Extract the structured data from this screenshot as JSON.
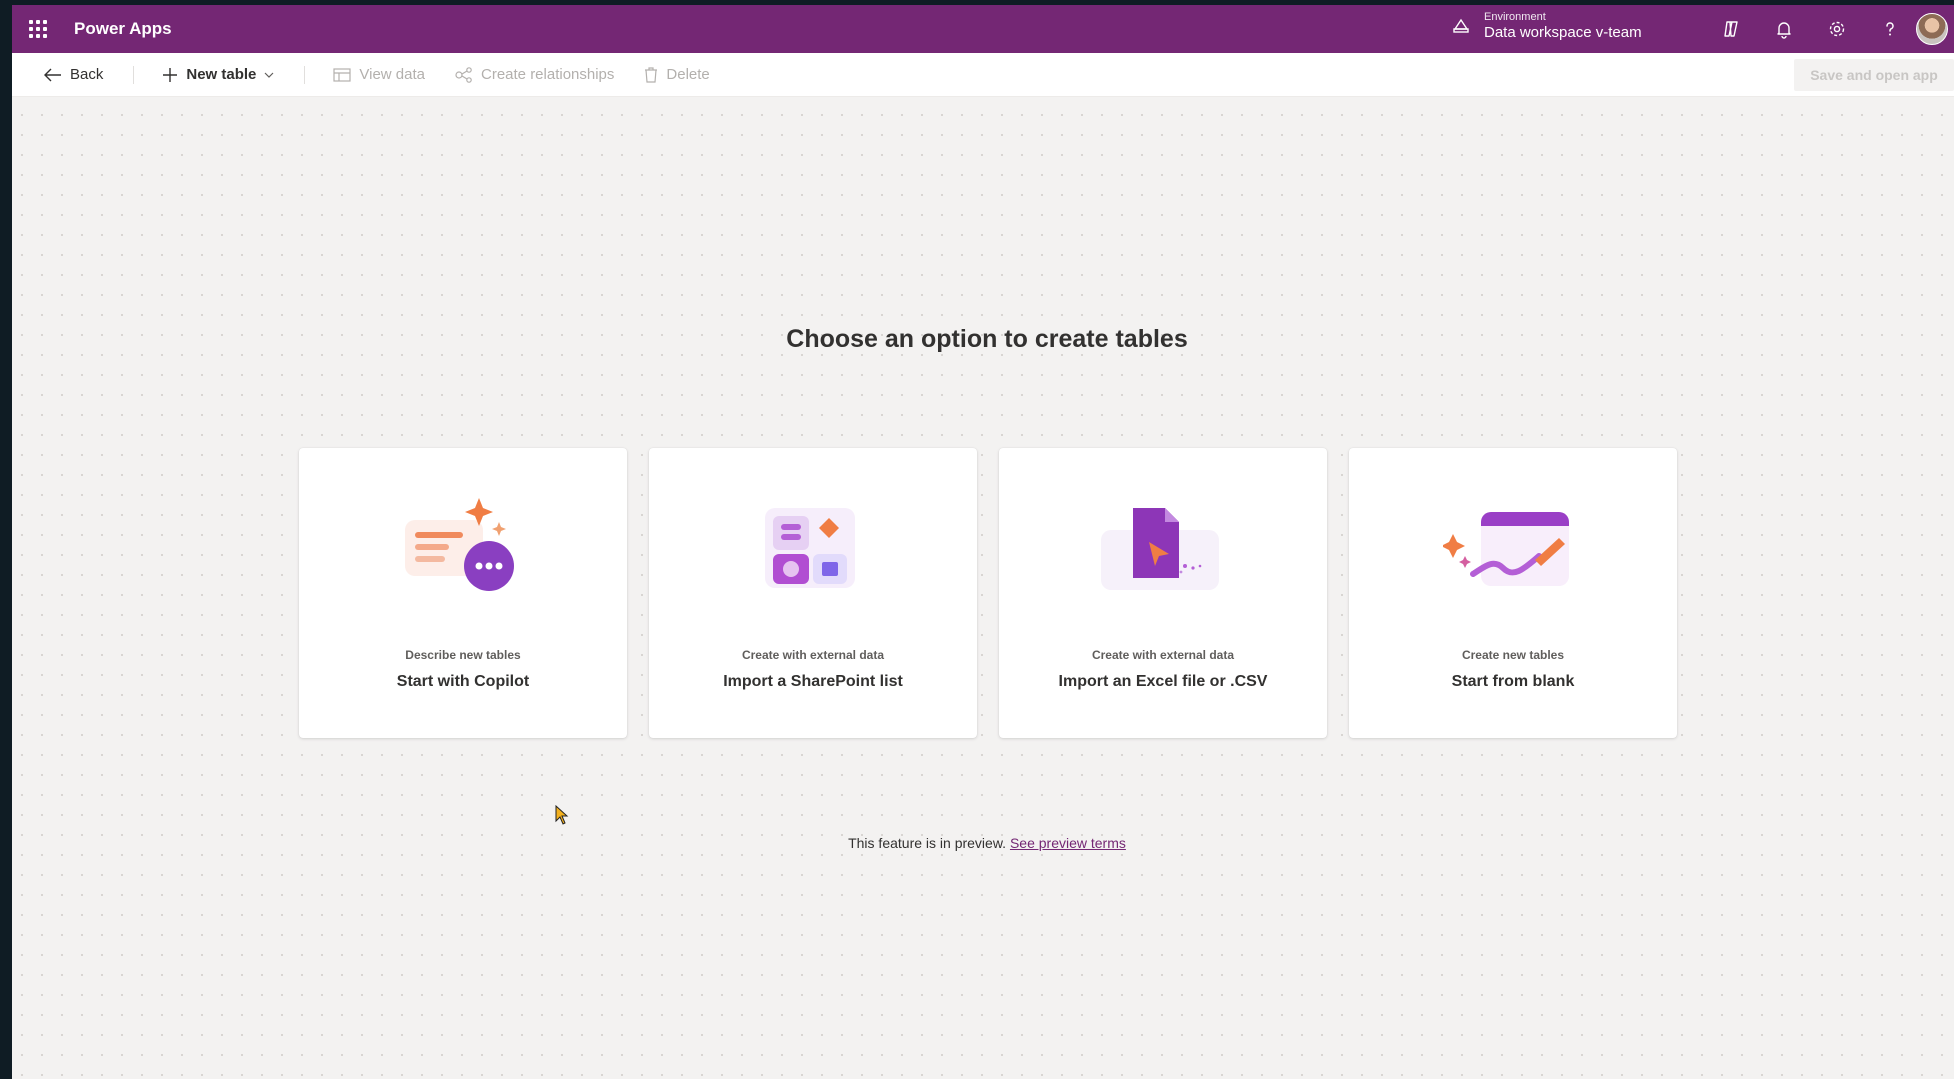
{
  "app": {
    "name": "Power Apps"
  },
  "environment": {
    "label": "Environment",
    "name": "Data workspace v-team"
  },
  "header_icons": [
    "copilot-icon",
    "bell-icon",
    "gear-icon",
    "help-icon"
  ],
  "commands": {
    "back": "Back",
    "new_table": "New table",
    "view_data": "View data",
    "create_relationships": "Create relationships",
    "delete": "Delete",
    "save_and_open_app": "Save and open app"
  },
  "main": {
    "heading": "Choose an option to create tables",
    "cards": [
      {
        "subtitle": "Describe new tables",
        "title": "Start with Copilot",
        "icon": "copilot-chat-icon"
      },
      {
        "subtitle": "Create with external data",
        "title": "Import a SharePoint list",
        "icon": "sharepoint-list-icon"
      },
      {
        "subtitle": "Create with external data",
        "title": "Import an Excel file or .CSV",
        "icon": "excel-file-icon"
      },
      {
        "subtitle": "Create new tables",
        "title": "Start from blank",
        "icon": "blank-table-icon"
      }
    ],
    "preview_text": "This feature is in preview.",
    "preview_link": "See preview terms"
  },
  "colors": {
    "brand": "#742774",
    "background": "#f3f2f1",
    "text": "#323130"
  }
}
